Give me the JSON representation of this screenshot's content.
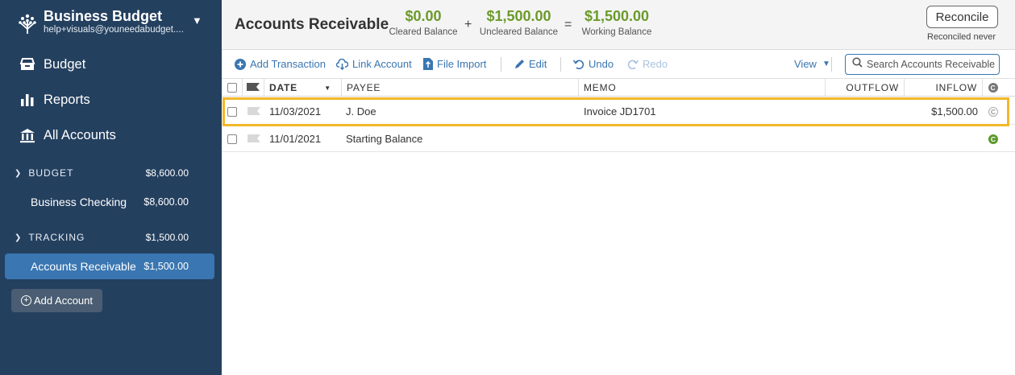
{
  "app": {
    "budget_name": "Business Budget",
    "user_email": "help+visuals@youneedabudget...."
  },
  "nav": {
    "budget": "Budget",
    "reports": "Reports",
    "all_accounts": "All Accounts"
  },
  "groups": {
    "budget": {
      "label": "BUDGET",
      "amount": "$8,600.00",
      "accounts": [
        {
          "name": "Business Checking",
          "amount": "$8,600.00"
        }
      ]
    },
    "tracking": {
      "label": "TRACKING",
      "amount": "$1,500.00",
      "accounts": [
        {
          "name": "Accounts Receivable",
          "amount": "$1,500.00"
        }
      ]
    }
  },
  "add_account_label": "Add Account",
  "header": {
    "title": "Accounts Receivable",
    "cleared_value": "$0.00",
    "cleared_label": "Cleared Balance",
    "plus_sign": "+",
    "uncleared_value": "$1,500.00",
    "uncleared_label": "Uncleared Balance",
    "equals_sign": "=",
    "working_value": "$1,500.00",
    "working_label": "Working Balance",
    "reconcile_label": "Reconcile",
    "reconciled_text": "Reconciled never",
    "balance_color": "#6b9a2a"
  },
  "toolbar": {
    "add_transaction": "Add Transaction",
    "link_account": "Link Account",
    "file_import": "File Import",
    "edit": "Edit",
    "undo": "Undo",
    "redo": "Redo",
    "view": "View",
    "search_placeholder": "Search Accounts Receivable"
  },
  "table": {
    "columns": {
      "date": "DATE",
      "payee": "PAYEE",
      "memo": "MEMO",
      "outflow": "OUTFLOW",
      "inflow": "INFLOW",
      "cleared": "C"
    },
    "rows": [
      {
        "date": "11/03/2021",
        "payee": "J. Doe",
        "memo": "Invoice JD1701",
        "outflow": "",
        "inflow": "$1,500.00",
        "cleared": "C",
        "cleared_state": "uncleared",
        "highlighted": true
      },
      {
        "date": "11/01/2021",
        "payee": "Starting Balance",
        "memo": "",
        "outflow": "",
        "inflow": "",
        "cleared": "C",
        "cleared_state": "cleared",
        "highlighted": false
      }
    ]
  },
  "colors": {
    "sidebar_bg": "#24405f",
    "active_account": "#3a76b1",
    "accent_blue": "#3a76b1",
    "highlight_border": "#f3b728",
    "positive_green": "#6b9a2a"
  }
}
